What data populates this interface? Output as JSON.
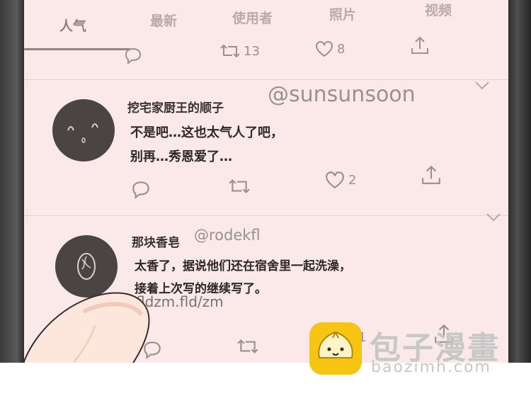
{
  "tabs": [
    "人气",
    "最新",
    "使用者",
    "照片",
    "视频"
  ],
  "top_row": {
    "retweets": "13",
    "likes": "8"
  },
  "tweets": [
    {
      "name": "挖宅家厨王的顺子",
      "handle": "@sunsunsoon",
      "body_line1": "不是吧…这也太气人了吧，",
      "body_line2": "别再…秀恩爱了…",
      "likes": "2"
    },
    {
      "name": "那块香皂",
      "handle": "@rodekfl",
      "body_line1": "太香了，据说他们还在宿舍里一起洗澡，",
      "body_line2": "接着上次写的继续写了。",
      "link": "fldzm.fld/zm",
      "likes": "1"
    }
  ],
  "watermark": {
    "cn": "包子漫畫",
    "en": "baozimh.com"
  },
  "colors": {
    "screen": "#fbe9e9",
    "icon": "#9b8f8f",
    "logo": "#f6c514"
  }
}
